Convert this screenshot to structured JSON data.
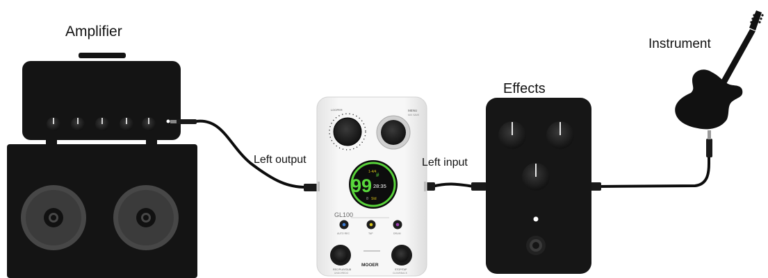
{
  "labels": {
    "amplifier": "Amplifier",
    "instrument": "Instrument",
    "effects": "Effects",
    "left_output": "Left output",
    "left_input": "Left input"
  },
  "pedal": {
    "brand": "MOOER",
    "model": "GL100",
    "looper_label": "LOOPER",
    "menu_label": "MENU",
    "menu_sub": "MIX SAVE",
    "screen": {
      "big_number": "99",
      "sharp": "#",
      "time": "28:35",
      "top_text": "1-4/4",
      "bottom_text": "Std",
      "left_marker": "8"
    },
    "buttons": [
      {
        "label": "AUTO REC",
        "color": "#3a7bd5"
      },
      {
        "label": "TAP",
        "color": "#d8c41a"
      },
      {
        "label": "DRUM",
        "color": "#9b3fb0"
      }
    ],
    "footswitch_left": "REC/PLAY/DUB",
    "footswitch_left_sub": "UNDO/REDO",
    "footswitch_right": "STOP/TAP",
    "footswitch_right_sub": "CLEAR/BACK"
  },
  "colors": {
    "amp": "#141414",
    "cabinet": "#141414",
    "speaker_ring": "#474747",
    "effects_body": "#161616",
    "cable": "#0c0c0c",
    "screen_ring": "#58d23a",
    "digits": "#59d83c"
  }
}
